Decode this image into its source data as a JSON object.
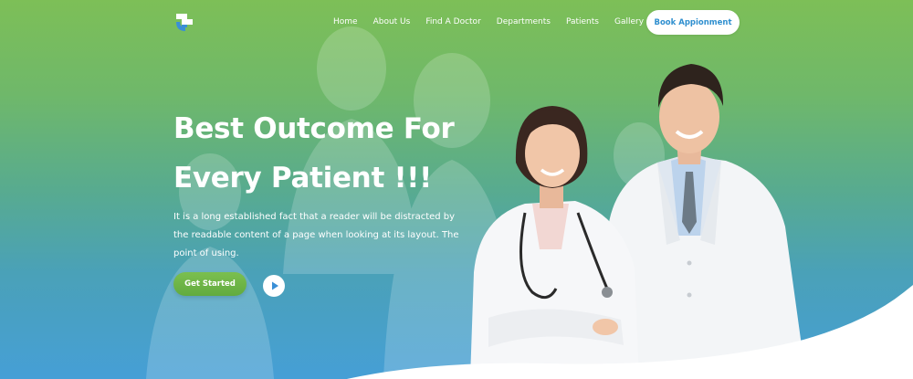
{
  "nav": {
    "items": [
      {
        "label": "Home"
      },
      {
        "label": "About Us"
      },
      {
        "label": "Find A Doctor"
      },
      {
        "label": "Departments"
      },
      {
        "label": "Patients"
      },
      {
        "label": "Gallery"
      }
    ],
    "book_label": "Book Appionment"
  },
  "hero": {
    "headline_line1": "Best Outcome For",
    "headline_line2": "Every Patient !!!",
    "subtext": "It is a long established fact that a reader will be distracted by the readable content of a page when looking at its layout. The point of using.",
    "cta_label": "Get Started"
  },
  "icons": {
    "logo": "medical-cross-logo",
    "play": "play-icon"
  },
  "colors": {
    "gradient_top": "#7dbf57",
    "gradient_bottom": "#469fd6",
    "book_text": "#2f8fcf",
    "cta_green": "#6bb447",
    "logo_blue": "#3a8fd6"
  }
}
